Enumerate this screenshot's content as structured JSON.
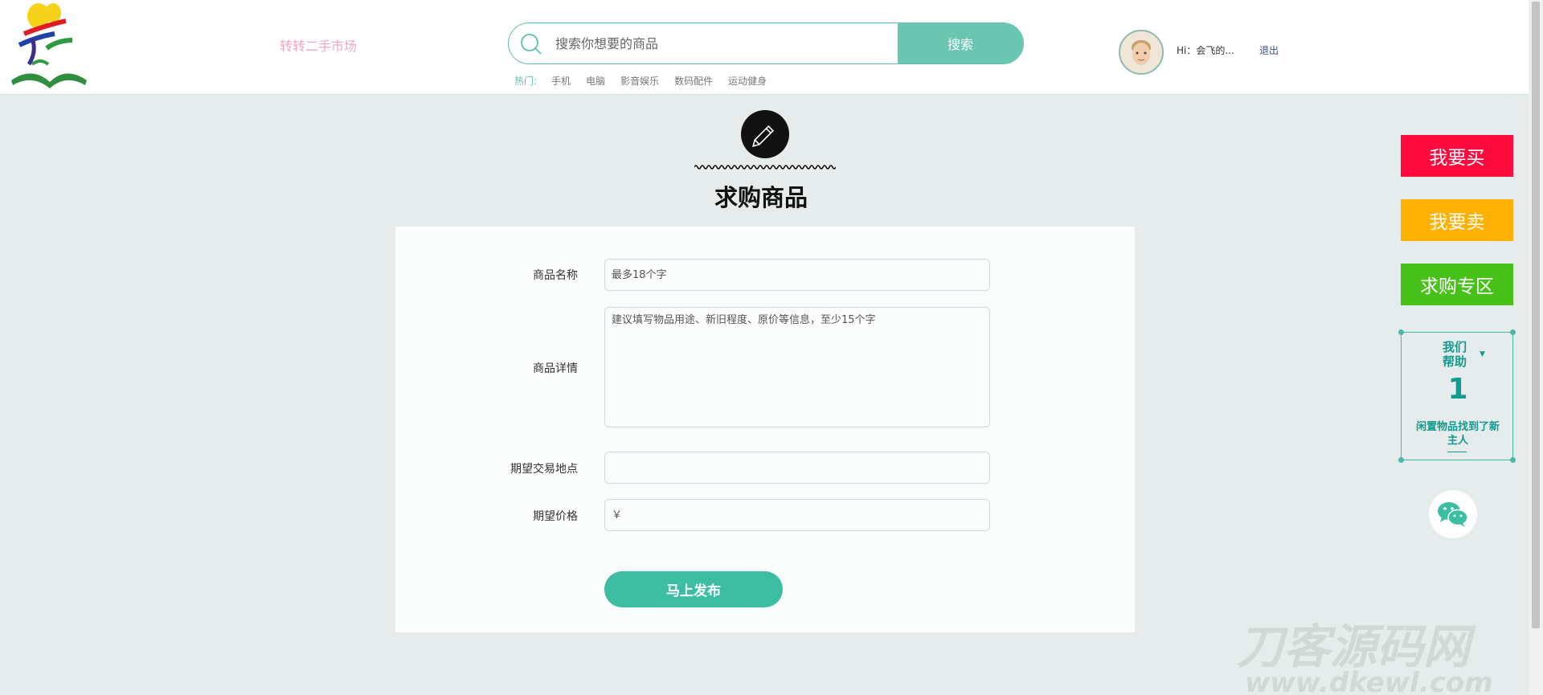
{
  "header": {
    "site_name": "转转二手市场",
    "search": {
      "placeholder": "搜索你想要的商品",
      "button_label": "搜索"
    },
    "hot": {
      "label": "热门:",
      "links": [
        "手机",
        "电脑",
        "影音娱乐",
        "数码配件",
        "运动健身"
      ]
    },
    "user": {
      "greeting": "Hi：会飞的...",
      "logout_label": "退出"
    }
  },
  "page": {
    "title": "求购商品"
  },
  "form": {
    "fields": {
      "name": {
        "label": "商品名称",
        "placeholder": "最多18个字"
      },
      "detail": {
        "label": "商品详情",
        "placeholder": "建议填写物品用途、新旧程度、原价等信息，至少15个字"
      },
      "location": {
        "label": "期望交易地点",
        "placeholder": ""
      },
      "price": {
        "label": "期望价格",
        "placeholder": "￥"
      }
    },
    "submit_label": "马上发布"
  },
  "sidebar": {
    "buy_label": "我要买",
    "sell_label": "我要卖",
    "request_label": "求购专区",
    "help": {
      "title": "我们帮助",
      "count": "1",
      "text": "闲置物品找到了新主人"
    }
  },
  "watermark": {
    "main": "刀客源码网",
    "url": "www.dkewl.com"
  },
  "colors": {
    "accent": "#3dbea2",
    "search_button": "#6ac6b1",
    "buy": "#fe0a3d",
    "sell": "#feb102",
    "request": "#48c21a"
  }
}
